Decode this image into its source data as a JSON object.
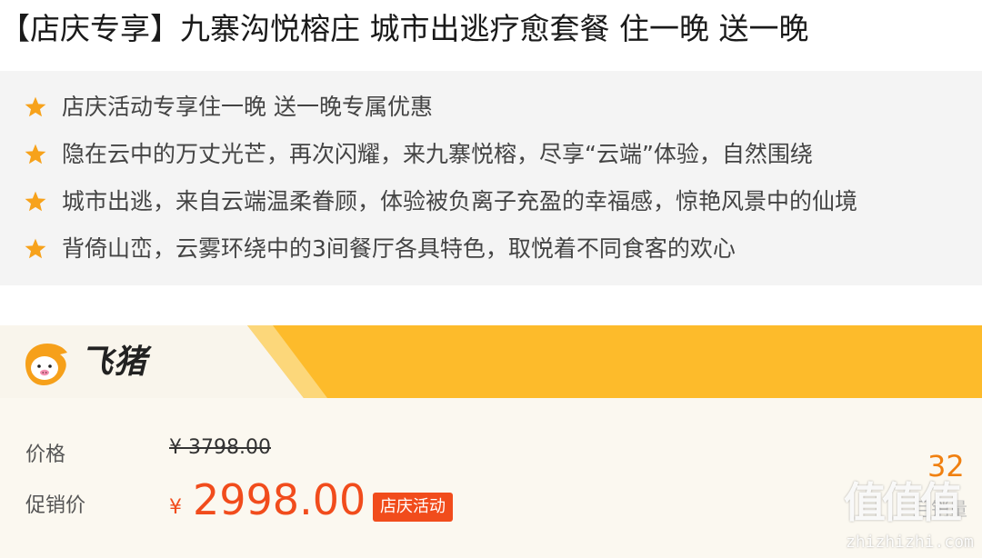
{
  "header": {
    "title": "【店庆专享】九寨沟悦榕庄 城市出逃疗愈套餐 住一晚 送一晚"
  },
  "highlights": {
    "icon": "star-icon",
    "icon_color": "#f7a21b",
    "items": [
      "店庆活动专享住一晚 送一晚专属优惠",
      "隐在云中的万丈光芒，再次闪耀，来九寨悦榕，尽享“云端”体验，自然围绕",
      "城市出逃，来自云端温柔眷顾，体验被负离子充盈的幸福感，惊艳风景中的仙境",
      "背倚山峦，云雾环绕中的3间餐厅各具特色，取悦着不同食客的欢心"
    ]
  },
  "platform": {
    "name": "飞猪",
    "logo_icon": "fliggy-logo-icon",
    "brand_color": "#fdbb2b"
  },
  "price": {
    "original_label": "价格",
    "original_currency": "¥",
    "original_value": "3798.00",
    "sale_label": "促销价",
    "sale_currency": "¥",
    "sale_value": "2998.00",
    "sale_color": "#f14c1c",
    "promo_badge": "店庆活动"
  },
  "side": {
    "count": "32",
    "label": "月销量"
  },
  "watermark": {
    "mark": "值值值",
    "url": "zhizhizhi.com"
  }
}
